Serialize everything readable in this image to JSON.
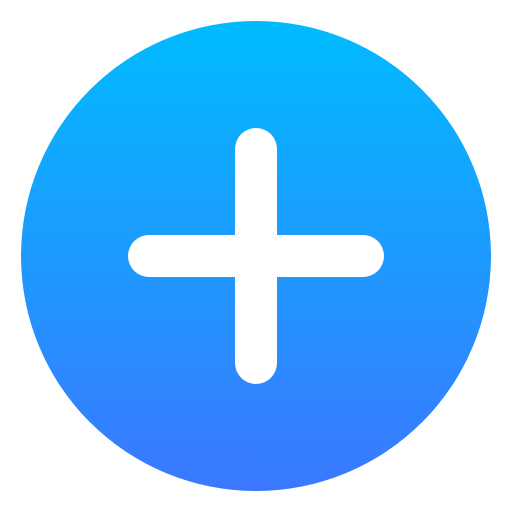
{
  "add_button": {
    "icon": "plus-icon",
    "gradient_top_color": "#00BBFF",
    "gradient_bottom_color": "#3B78FF",
    "glyph_color": "#FFFFFF"
  }
}
